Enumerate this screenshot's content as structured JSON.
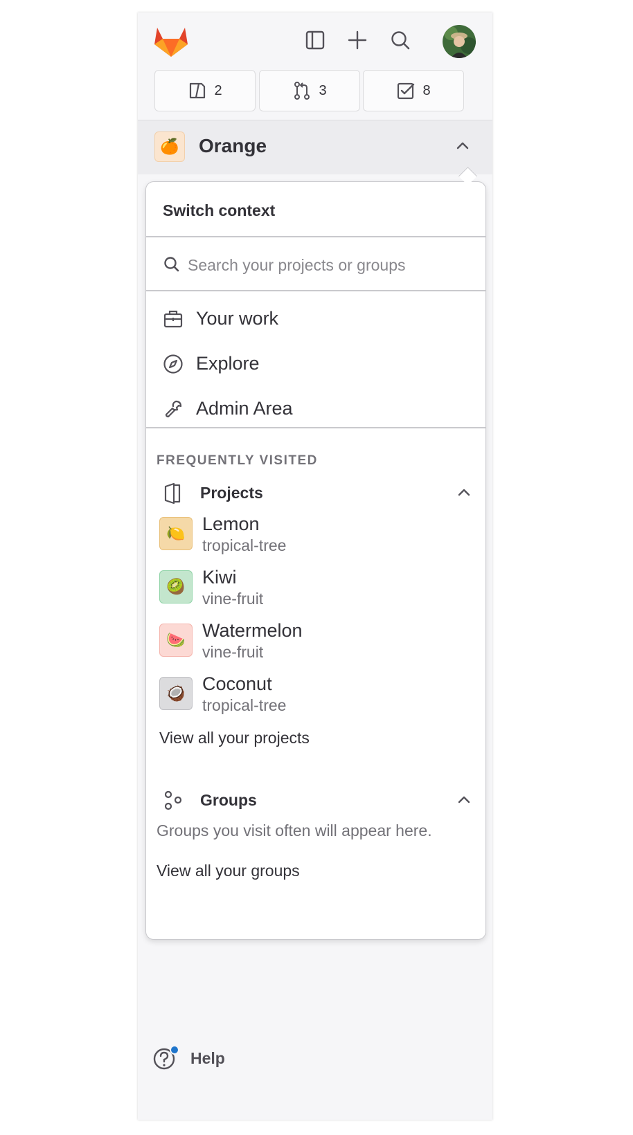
{
  "topbar": {
    "logo": "gitlab-tanuki-logo",
    "icons": [
      "sidebar-toggle-icon",
      "plus-icon",
      "search-icon"
    ],
    "avatar": "user-avatar"
  },
  "counters": [
    {
      "icon": "issues-icon",
      "count": "2"
    },
    {
      "icon": "merge-request-icon",
      "count": "3"
    },
    {
      "icon": "todo-icon",
      "count": "8"
    }
  ],
  "context": {
    "title": "Orange",
    "emoji": "🍊"
  },
  "panel": {
    "header": "Switch context",
    "search_placeholder": "Search your projects or groups",
    "nav": [
      {
        "label": "Your work",
        "icon": "briefcase-icon"
      },
      {
        "label": "Explore",
        "icon": "compass-icon"
      },
      {
        "label": "Admin Area",
        "icon": "wrench-icon"
      }
    ],
    "section_label": "FREQUENTLY VISITED",
    "projects": {
      "title": "Projects",
      "items": [
        {
          "name": "Lemon",
          "namespace": "tropical-tree",
          "emoji": "🍋",
          "bg": "#f5d9a8",
          "border": "#e9c07a"
        },
        {
          "name": "Kiwi",
          "namespace": "vine-fruit",
          "emoji": "🥝",
          "bg": "#c3e6cd",
          "border": "#91d4a8"
        },
        {
          "name": "Watermelon",
          "namespace": "vine-fruit",
          "emoji": "🍉",
          "bg": "#fcd9d4",
          "border": "#f5b5ad"
        },
        {
          "name": "Coconut",
          "namespace": "tropical-tree",
          "emoji": "🥥",
          "bg": "#dcdcde",
          "border": "#bfbfc3"
        }
      ],
      "view_all": "View all your projects"
    },
    "groups": {
      "title": "Groups",
      "empty_text": "Groups you visit often will appear here.",
      "view_all": "View all your groups"
    }
  },
  "help": {
    "label": "Help"
  }
}
